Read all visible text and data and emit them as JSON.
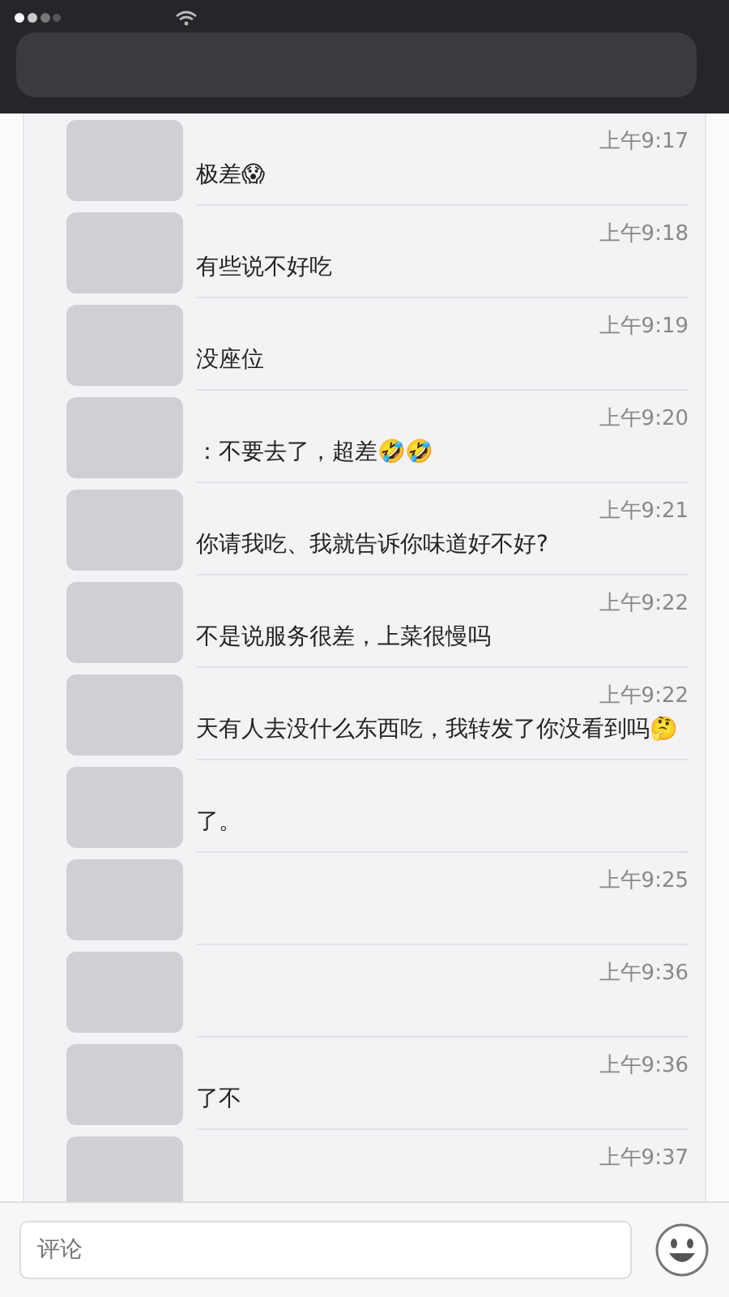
{
  "comments": [
    {
      "time": "上午9:17",
      "text": "极差😱"
    },
    {
      "time": "上午9:18",
      "text": "有些说不好吃"
    },
    {
      "time": "上午9:19",
      "text": "没座位"
    },
    {
      "time": "上午9:20",
      "text": "：不要去了，超差🤣🤣"
    },
    {
      "time": "上午9:21",
      "text": "你请我吃、我就告诉你味道好不好?"
    },
    {
      "time": "上午9:22",
      "text": "不是说服务很差，上菜很慢吗"
    },
    {
      "time": "上午9:22",
      "text": "天有人去没什么东西吃，我转发了你没看到吗🤔"
    },
    {
      "text": "了。"
    },
    {
      "time": "上午9:25"
    },
    {
      "time": "上午9:36"
    },
    {
      "time": "上午9:36",
      "text": "了不"
    },
    {
      "time": "上午9:37"
    }
  ],
  "input": {
    "placeholder": "评论"
  }
}
